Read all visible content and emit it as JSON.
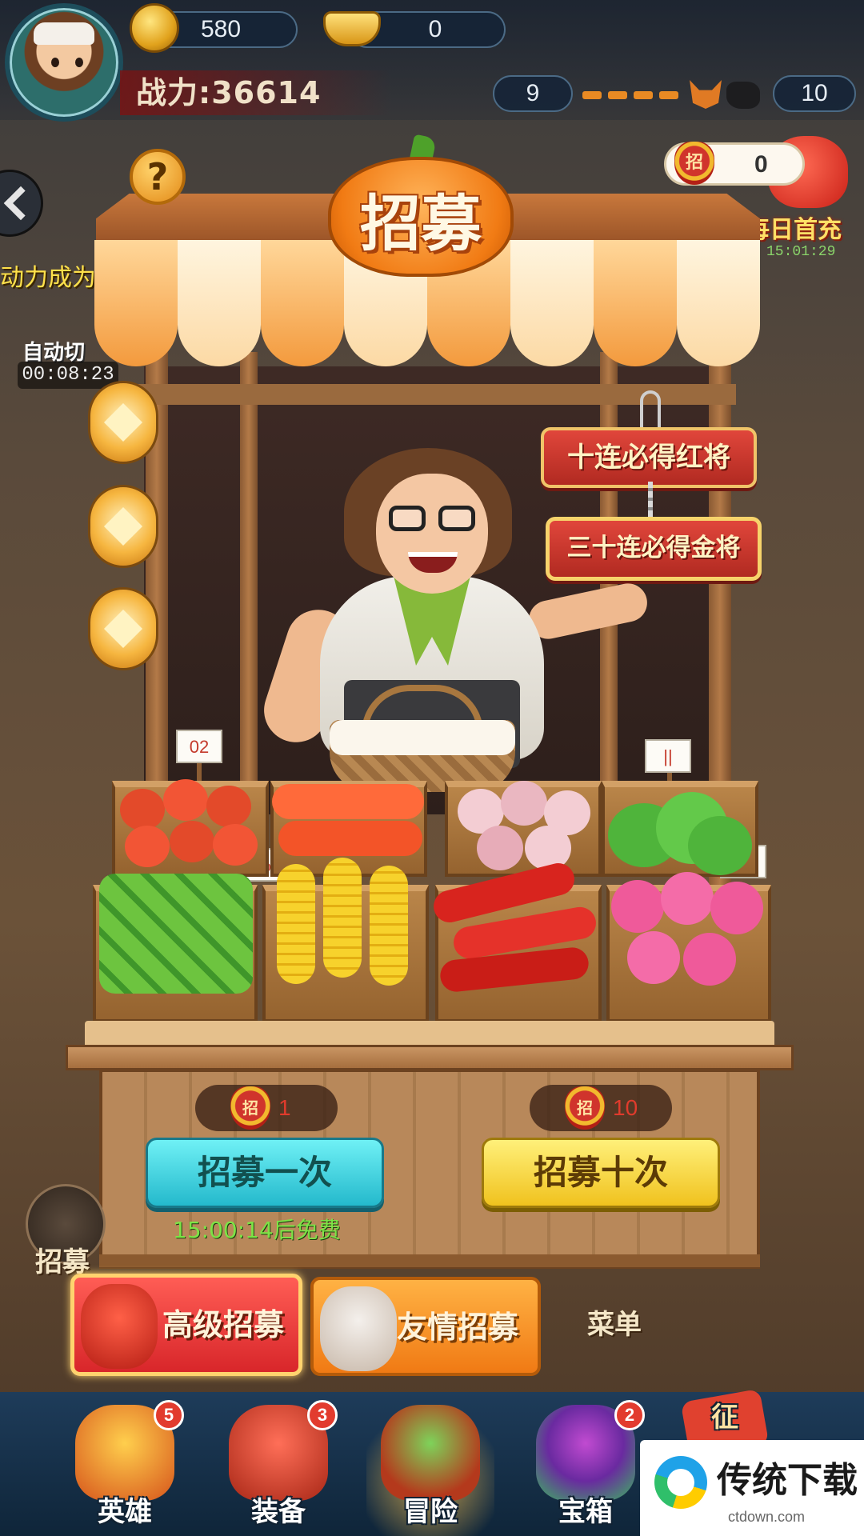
{
  "top_bar": {
    "coins": "580",
    "ingots": "0",
    "power_label": "战力:36614",
    "stamina_left": "9",
    "stamina_right": "10"
  },
  "side": {
    "marquee": "动力成为顶尖大厨!",
    "auto_label": "自动切",
    "auto_timer": "00:08:23",
    "daily_recharge": "每日首充",
    "daily_timer": "15:01:29",
    "ticket_count": "0",
    "recruit_side_label": "招募"
  },
  "stall": {
    "title": "招募",
    "help_symbol": "?",
    "sign_red_general": "十连必得红将",
    "sign_gold_general": "三十连必得金将",
    "price_tags": [
      "02",
      "%",
      "||",
      "%"
    ]
  },
  "recruit": {
    "ticket_icon_char": "招",
    "once_cost": "1",
    "ten_cost": "10",
    "once_label": "招募一次",
    "ten_label": "招募十次",
    "free_timer": "15:00:14后免费"
  },
  "modes": {
    "advanced": "高级招募",
    "friend": "友情招募",
    "menu": "菜单"
  },
  "nav": {
    "items": [
      {
        "label": "英雄",
        "badge": "5"
      },
      {
        "label": "装备",
        "badge": "3"
      },
      {
        "label": "冒险",
        "badge": ""
      },
      {
        "label": "宝箱",
        "badge": "2"
      },
      {
        "label": "征",
        "badge": ""
      }
    ]
  },
  "watermark": {
    "title": "传统下载",
    "url": "ctdown.com"
  },
  "colors": {
    "accent_orange": "#f17b14",
    "button_cyan": "#24b9cc",
    "button_yellow": "#f0c21e",
    "timer_green": "#7de346",
    "badge_red": "#e23b2e"
  }
}
